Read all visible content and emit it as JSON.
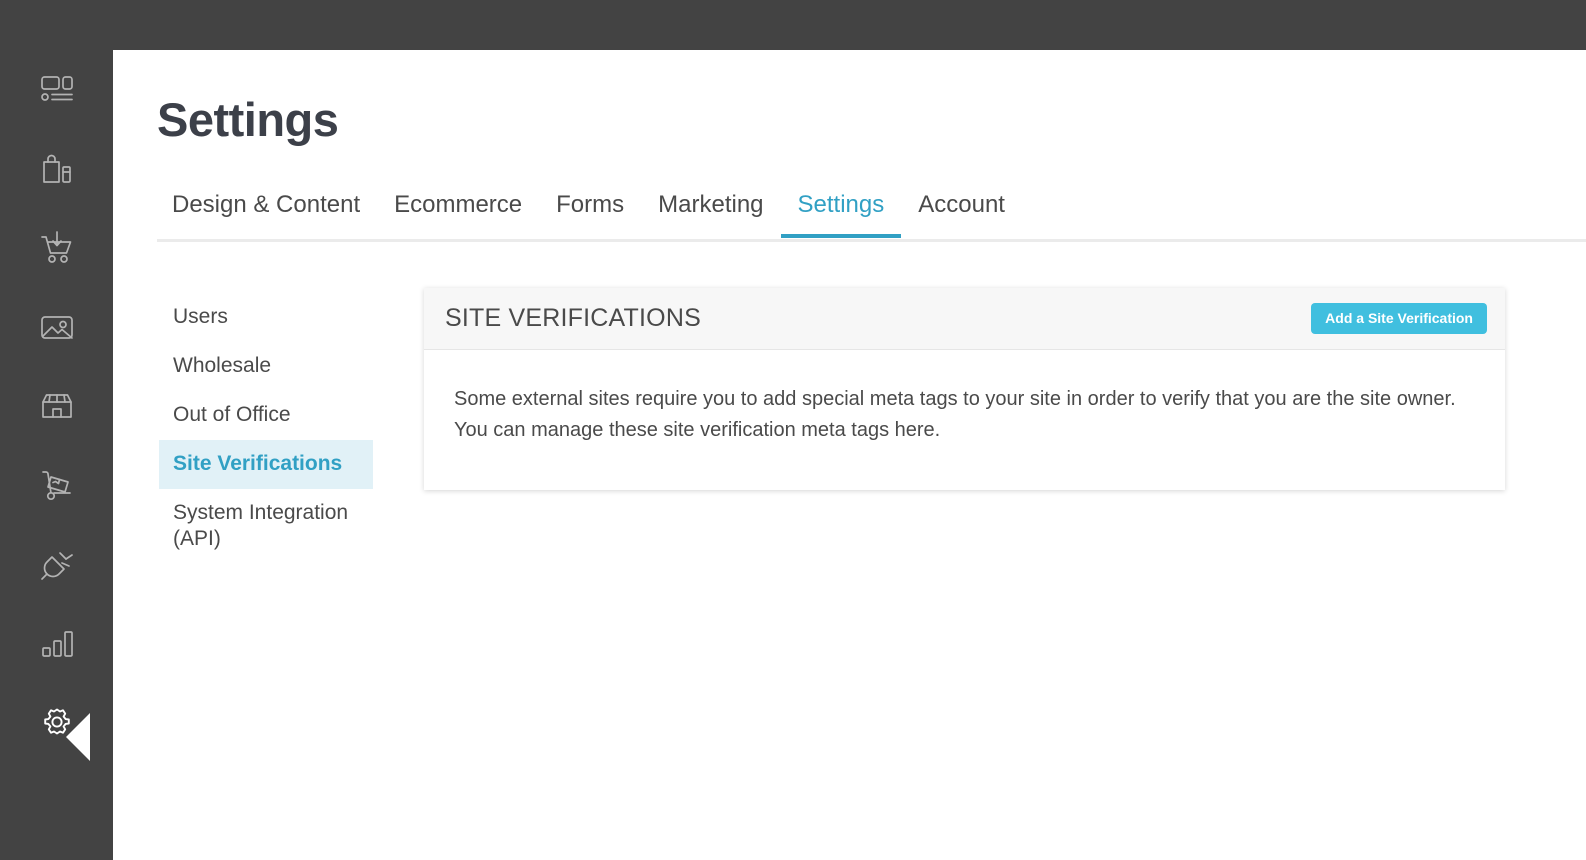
{
  "window": {
    "topbar_color": "#434343",
    "accent_color": "#31a0c4",
    "button_color": "#40bfdf"
  },
  "sidebar": {
    "items": [
      {
        "icon": "dashboard-layout-icon",
        "label": "Dashboard",
        "active": false
      },
      {
        "icon": "shopping-bag-icon",
        "label": "Products",
        "active": false
      },
      {
        "icon": "cart-download-icon",
        "label": "Orders",
        "active": false
      },
      {
        "icon": "image-gallery-icon",
        "label": "Media",
        "active": false
      },
      {
        "icon": "storefront-icon",
        "label": "Store",
        "active": false
      },
      {
        "icon": "hand-truck-icon",
        "label": "Shipping",
        "active": false
      },
      {
        "icon": "power-plug-icon",
        "label": "Integrations",
        "active": false
      },
      {
        "icon": "bar-chart-icon",
        "label": "Reports",
        "active": false
      },
      {
        "icon": "gear-icon",
        "label": "Settings",
        "active": true
      }
    ]
  },
  "header": {
    "title": "Settings"
  },
  "tabs": [
    {
      "label": "Design & Content",
      "active": false
    },
    {
      "label": "Ecommerce",
      "active": false
    },
    {
      "label": "Forms",
      "active": false
    },
    {
      "label": "Marketing",
      "active": false
    },
    {
      "label": "Settings",
      "active": true
    },
    {
      "label": "Account",
      "active": false
    }
  ],
  "subnav": [
    {
      "label": "Users",
      "active": false
    },
    {
      "label": "Wholesale",
      "active": false
    },
    {
      "label": "Out of Office",
      "active": false
    },
    {
      "label": "Site Verifications",
      "active": true
    },
    {
      "label": "System Integration (API)",
      "active": false
    }
  ],
  "panel": {
    "title": "SITE VERIFICATIONS",
    "add_button_label": "Add a Site Verification",
    "description": "Some external sites require you to add special meta tags to your site in order to verify that you are the site owner. You can manage these site verification meta tags here."
  }
}
